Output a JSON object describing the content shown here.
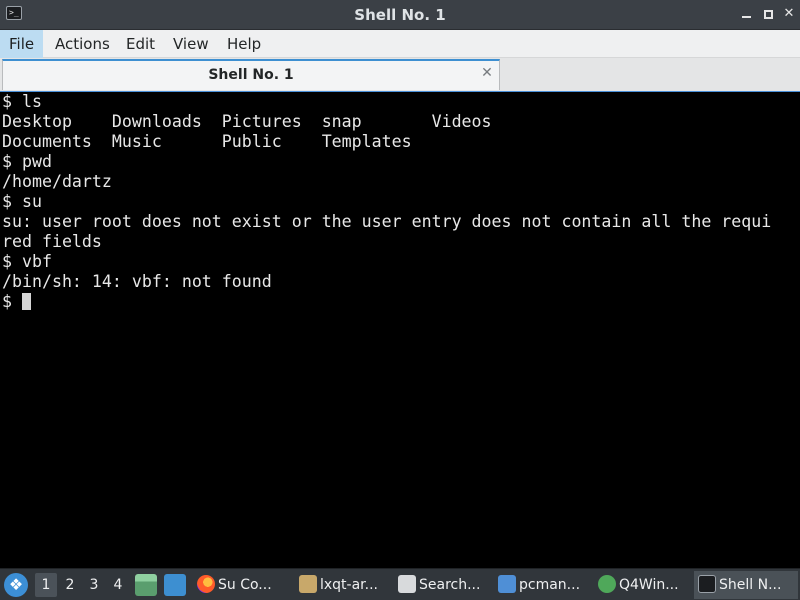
{
  "window": {
    "title": "Shell No. 1",
    "icon": "terminal-icon",
    "controls": [
      "minimize-icon",
      "maximize-icon",
      "close-icon"
    ]
  },
  "menubar": {
    "items": [
      {
        "label": "File",
        "active": true
      },
      {
        "label": "Actions"
      },
      {
        "label": "Edit"
      },
      {
        "label": "View"
      },
      {
        "label": "Help"
      }
    ]
  },
  "tabs": [
    {
      "label": "Shell No. 1",
      "close_icon": "close-icon"
    }
  ],
  "terminal": {
    "lines": [
      "$ ls",
      "Desktop    Downloads  Pictures  snap       Videos",
      "Documents  Music      Public    Templates",
      "$ pwd",
      "/home/dartz",
      "$ su",
      "su: user root does not exist or the user entry does not contain all the requi",
      "red fields",
      "$ vbf",
      "/bin/sh: 14: vbf: not found"
    ],
    "prompt": "$ "
  },
  "taskbar": {
    "start_icon": "lxqt-menu-icon",
    "desktops": [
      "1",
      "2",
      "3",
      "4"
    ],
    "active_desktop": "1",
    "quicklaunch": [
      "file-manager-icon",
      "show-desktop-icon"
    ],
    "tasks": [
      {
        "label": "Su Co...",
        "icon": "firefox-icon"
      },
      {
        "label": "lxqt-ar...",
        "icon": "archive-icon"
      },
      {
        "label": "Search...",
        "icon": "package-search-icon"
      },
      {
        "label": "pcman...",
        "icon": "folder-icon"
      },
      {
        "label": "Q4Win...",
        "icon": "wine-icon"
      },
      {
        "label": "Shell N...",
        "icon": "terminal-icon",
        "active": true
      }
    ]
  },
  "colors": {
    "accent": "#3d8fd1",
    "terminal_bg": "#000000",
    "terminal_fg": "#e8e8e8",
    "taskbar_bg": "#31363b"
  }
}
